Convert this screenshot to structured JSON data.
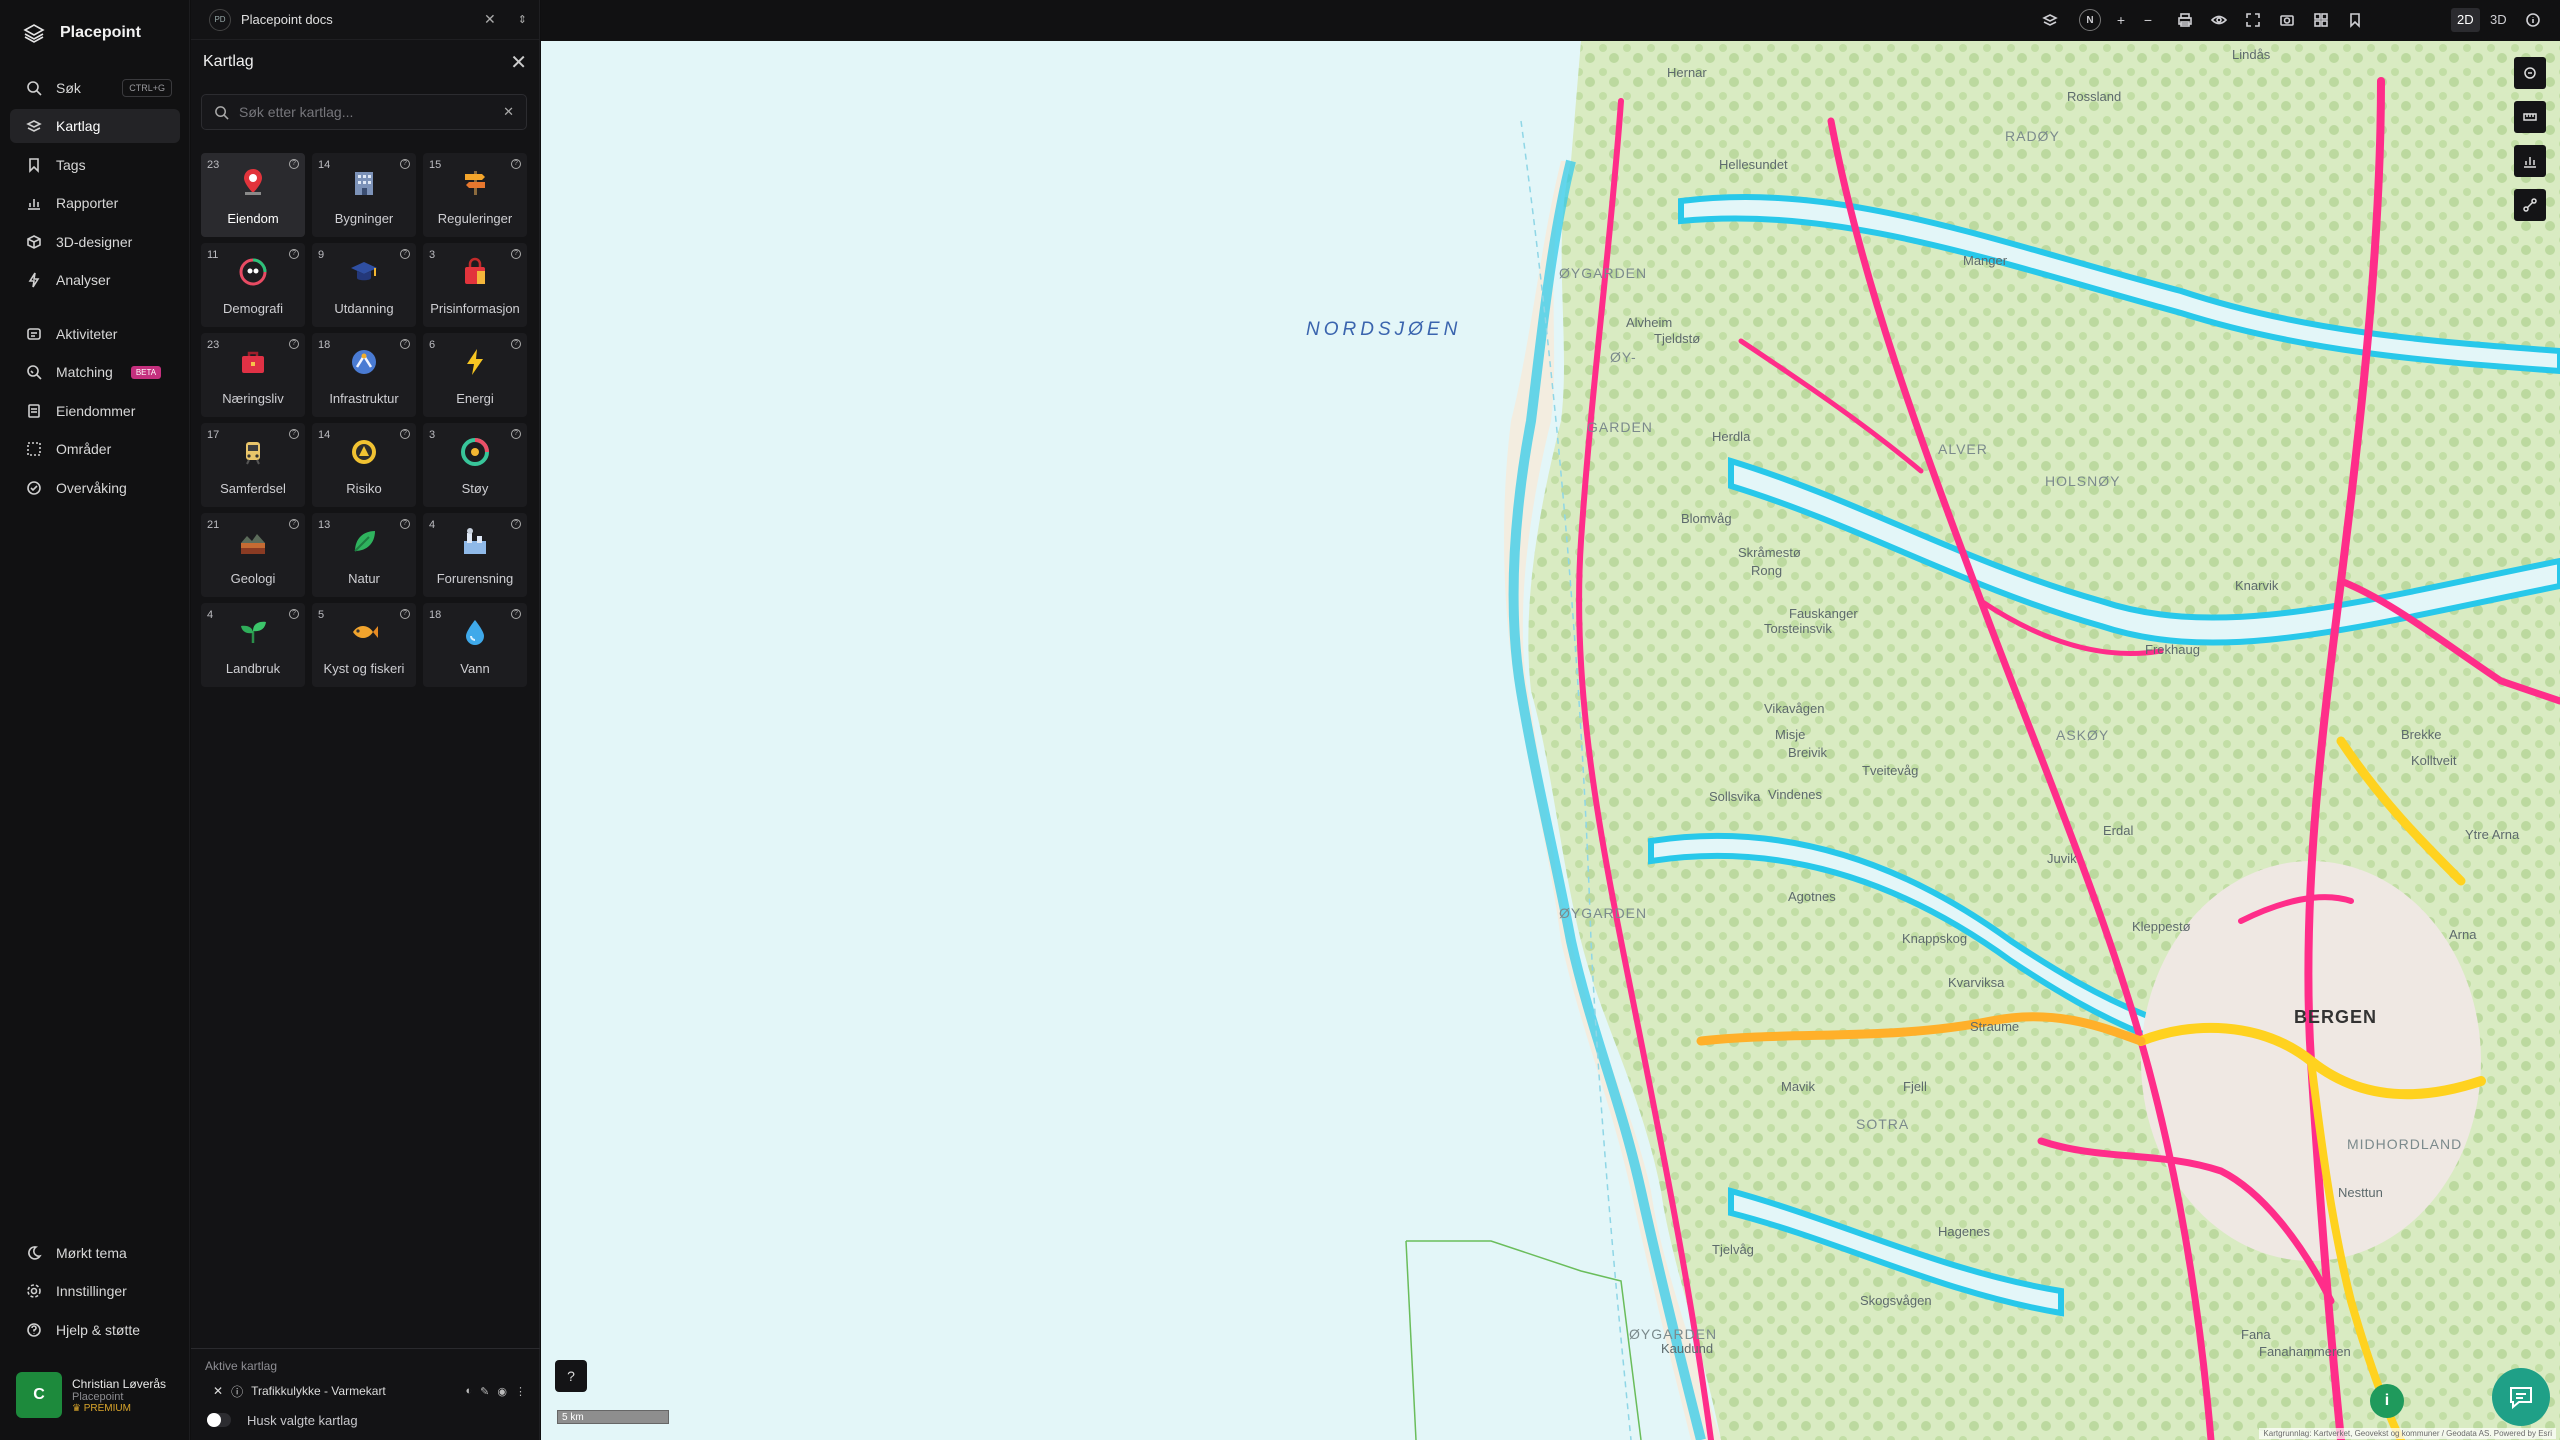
{
  "app": {
    "name": "Placepoint"
  },
  "nav": {
    "items": [
      {
        "label": "Søk",
        "shortcut": "CTRL+G"
      },
      {
        "label": "Kartlag"
      },
      {
        "label": "Tags"
      },
      {
        "label": "Rapporter"
      },
      {
        "label": "3D-designer"
      },
      {
        "label": "Analyser"
      },
      {
        "label": "Aktiviteter"
      },
      {
        "label": "Matching",
        "badge": "BETA"
      },
      {
        "label": "Eiendommer"
      },
      {
        "label": "Områder"
      },
      {
        "label": "Overvåking"
      }
    ],
    "bottom": [
      {
        "label": "Mørkt tema"
      },
      {
        "label": "Innstillinger"
      },
      {
        "label": "Hjelp & støtte"
      }
    ],
    "profile": {
      "initial": "C",
      "name": "Christian Løverås",
      "org": "Placepoint",
      "tier": "PREMIUM"
    }
  },
  "workspace": {
    "badge": "PD",
    "name": "Placepoint docs"
  },
  "panel": {
    "title": "Kartlag",
    "search_placeholder": "Søk etter kartlag...",
    "categories": [
      {
        "count": "23",
        "label": "Eiendom",
        "icon": "house-pin-icon"
      },
      {
        "count": "14",
        "label": "Bygninger",
        "icon": "building-icon"
      },
      {
        "count": "15",
        "label": "Reguleringer",
        "icon": "signpost-icon"
      },
      {
        "count": "11",
        "label": "Demografi",
        "icon": "demography-icon"
      },
      {
        "count": "9",
        "label": "Utdanning",
        "icon": "graduation-cap-icon"
      },
      {
        "count": "3",
        "label": "Prisinformasjon",
        "icon": "shopping-bag-icon"
      },
      {
        "count": "23",
        "label": "Næringsliv",
        "icon": "business-bag-icon"
      },
      {
        "count": "18",
        "label": "Infrastruktur",
        "icon": "infrastructure-icon"
      },
      {
        "count": "6",
        "label": "Energi",
        "icon": "lightning-icon"
      },
      {
        "count": "17",
        "label": "Samferdsel",
        "icon": "tram-icon"
      },
      {
        "count": "14",
        "label": "Risiko",
        "icon": "hazard-icon"
      },
      {
        "count": "3",
        "label": "Støy",
        "icon": "noise-gauge-icon"
      },
      {
        "count": "21",
        "label": "Geologi",
        "icon": "geology-icon"
      },
      {
        "count": "13",
        "label": "Natur",
        "icon": "leaf-icon"
      },
      {
        "count": "4",
        "label": "Forurensning",
        "icon": "factory-icon"
      },
      {
        "count": "4",
        "label": "Landbruk",
        "icon": "sprout-icon"
      },
      {
        "count": "5",
        "label": "Kyst og fiskeri",
        "icon": "fish-icon"
      },
      {
        "count": "18",
        "label": "Vann",
        "icon": "water-drop-icon"
      }
    ],
    "active_label": "Aktive kartlag",
    "active_layers": [
      {
        "label": "Trafikkulykke - Varmekart"
      }
    ],
    "remember_label": "Husk valgte kartlag"
  },
  "toolbar": {
    "mode_2d": "2D",
    "mode_3d": "3D",
    "north": "N"
  },
  "map": {
    "sea_label": "NORDSJØEN",
    "city_label": "BERGEN",
    "places": [
      "ØYGARDEN",
      "ØY-",
      "GARDEN",
      "ALVER",
      "HOLSNØY",
      "ASKØY",
      "SOTRA",
      "BERGEN",
      "MIDHORDLAND",
      "RADØY",
      "Hernar",
      "Hellesundet",
      "Alvheim",
      "Tjeldstø",
      "Herdla",
      "Fauskanger",
      "Knarvik",
      "Frekhaug",
      "Skråmestø",
      "Breivik",
      "Tveitevåg",
      "Erdal",
      "Kleppestø",
      "Juvik",
      "Agotnes",
      "Knappskog",
      "Kvarviksa",
      "Fjell",
      "Straume",
      "Hagenes",
      "Tjelvåg",
      "Skogsvågen",
      "Fana",
      "Fanahammeren",
      "Nesttun",
      "Arna",
      "Ytre Arna",
      "Lindås",
      "Manger",
      "Rossland",
      "Sollsvika",
      "Vindenes",
      "Mavik",
      "Kaudund",
      "Blomvåg",
      "Rong",
      "Torsteinsvik",
      "Vikavågen",
      "Misje",
      "Brekke",
      "Kolltveit"
    ],
    "scale": "5 km",
    "attribution": "Kartgrunnlag: Kartverket, Geovekst og kommuner / Geodata AS. Powered by Esri"
  }
}
